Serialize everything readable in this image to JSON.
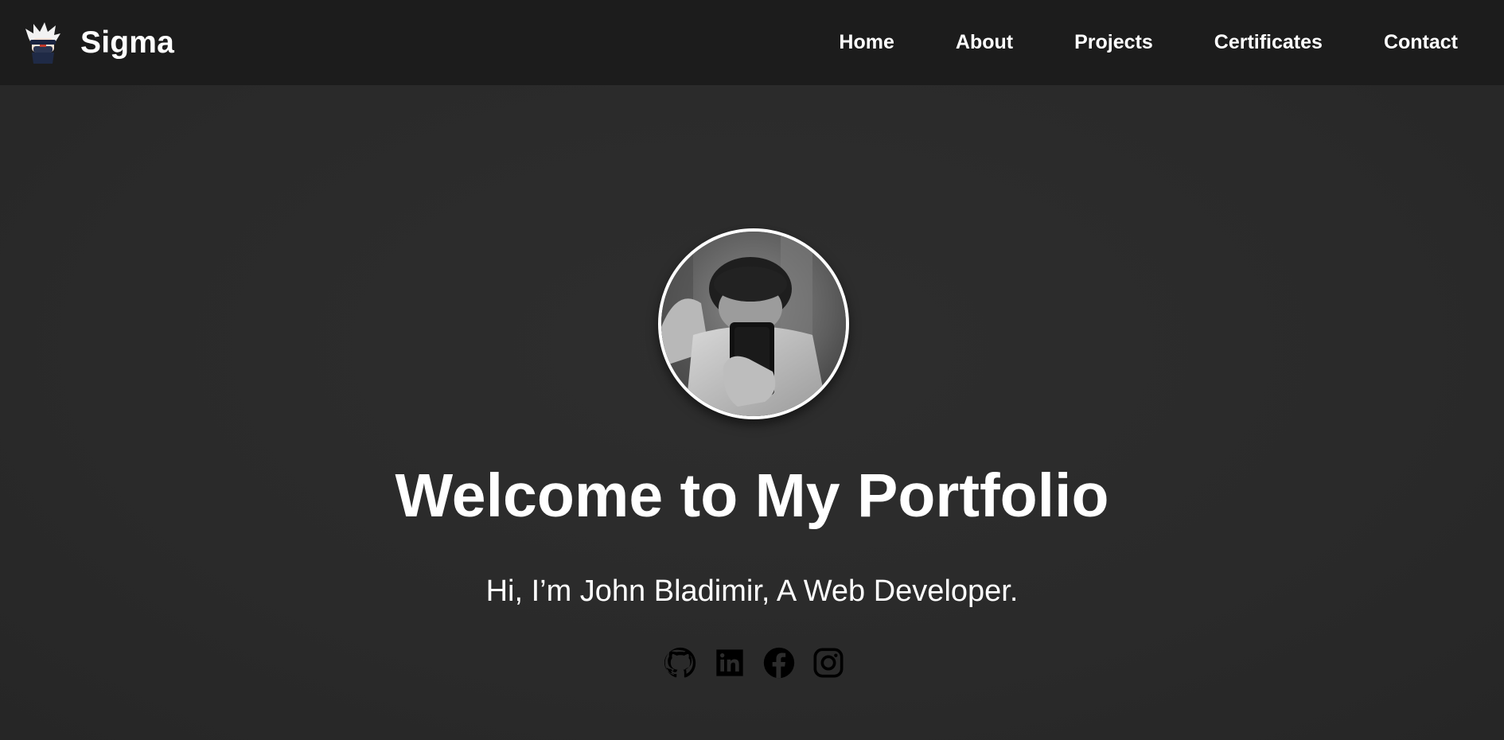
{
  "brand": {
    "name": "Sigma",
    "logo_icon": "ninja-mascot-icon"
  },
  "nav": {
    "items": [
      {
        "label": "Home"
      },
      {
        "label": "About"
      },
      {
        "label": "Projects"
      },
      {
        "label": "Certificates"
      },
      {
        "label": "Contact"
      }
    ]
  },
  "hero": {
    "avatar_icon": "profile-photo",
    "title": "Welcome to My Portfolio",
    "subtitle": "Hi, I’m John Bladimir, A Web Developer."
  },
  "socials": [
    {
      "icon": "github-icon"
    },
    {
      "icon": "linkedin-icon"
    },
    {
      "icon": "facebook-icon"
    },
    {
      "icon": "instagram-icon"
    }
  ],
  "colors": {
    "navbar_bg": "#1c1c1c",
    "page_bg": "#2c2c2c",
    "text": "#ffffff",
    "social_icon": "#000000"
  }
}
